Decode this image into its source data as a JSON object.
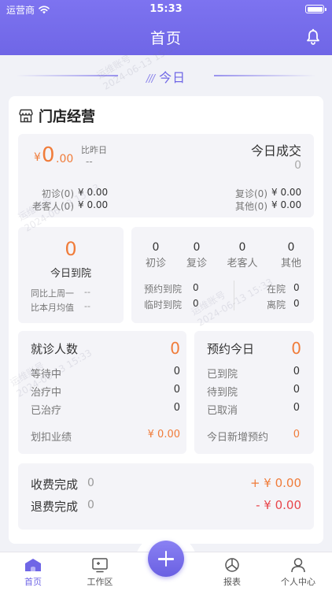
{
  "status_bar": {
    "carrier": "运营商",
    "time": "15:33"
  },
  "header": {
    "title": "首页"
  },
  "today": {
    "label": "今日",
    "slashes": "///"
  },
  "store": {
    "title": "门店经营",
    "revenue": {
      "currency": "¥",
      "amount": "0",
      "decimals": ".00",
      "vs_yesterday_label": "比昨日",
      "vs_yesterday_value": "--",
      "deals_label": "今日成交",
      "deals_value": "0",
      "first_visit": "初诊(0)",
      "first_visit_amount": "¥ 0.00",
      "old_customer": "老客人(0)",
      "old_customer_amount": "¥ 0.00",
      "revisit": "复诊(0)",
      "revisit_amount": "¥ 0.00",
      "other": "其他(0)",
      "other_amount": "¥ 0.00"
    },
    "arrival": {
      "count": "0",
      "label": "今日到院",
      "week_label": "同比上周一",
      "week_value": "--",
      "month_label": "比本月均值",
      "month_value": "--"
    },
    "visit_types": [
      {
        "value": "0",
        "label": "初诊"
      },
      {
        "value": "0",
        "label": "复诊"
      },
      {
        "value": "0",
        "label": "老客人"
      },
      {
        "value": "0",
        "label": "其他"
      }
    ],
    "arrival_detail": {
      "appointment_label": "预约到院",
      "appointment_value": "0",
      "temp_label": "临时到院",
      "temp_value": "0",
      "in_label": "在院",
      "in_value": "0",
      "left_label": "离院",
      "left_value": "0"
    },
    "patients": {
      "title": "就诊人数",
      "count": "0",
      "rows": [
        {
          "label": "等待中",
          "value": "0"
        },
        {
          "label": "治疗中",
          "value": "0"
        },
        {
          "label": "已治疗",
          "value": "0"
        }
      ],
      "footer_label": "划扣业绩",
      "footer_value": "¥ 0.00"
    },
    "appointments": {
      "title": "预约今日",
      "count": "0",
      "rows": [
        {
          "label": "已到院",
          "value": "0"
        },
        {
          "label": "待到院",
          "value": "0"
        },
        {
          "label": "已取消",
          "value": "0"
        }
      ],
      "footer_label": "今日新增预约",
      "footer_value": "0"
    },
    "charges": {
      "done_label": "收费完成",
      "done_count": "0",
      "done_amount": "+ ¥ 0.00",
      "refund_label": "退费完成",
      "refund_count": "0",
      "refund_amount": "- ¥ 0.00"
    }
  },
  "tabs": [
    {
      "label": "首页",
      "icon": "home-icon"
    },
    {
      "label": "工作区",
      "icon": "workspace-icon"
    },
    {
      "label": "报表",
      "icon": "report-icon"
    },
    {
      "label": "个人中心",
      "icon": "profile-icon"
    }
  ],
  "watermark": {
    "account": "运维账号",
    "timestamp": "2024-06-13 15:33"
  },
  "colors": {
    "primary": "#6f66e6",
    "accent_orange": "#f07c3a",
    "accent_red": "#e8464b"
  }
}
